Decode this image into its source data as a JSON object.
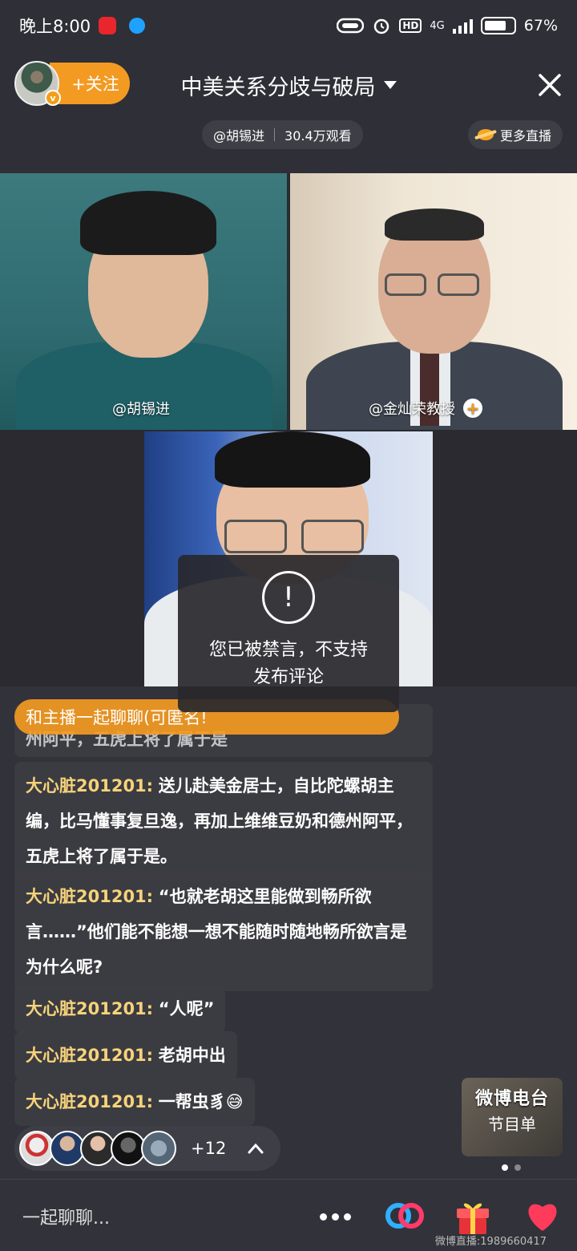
{
  "status_bar": {
    "time": "晚上8:00",
    "network": "4G",
    "hd": "HD",
    "battery": "67%"
  },
  "header": {
    "follow_label": "+关注",
    "title": "中美关系分歧与破局",
    "host": "@胡锡进",
    "views": "30.4万观看",
    "more_live": "更多直播"
  },
  "video": {
    "tile1_label": "@胡锡进",
    "tile2_label": "@金灿荣教授"
  },
  "toast": {
    "icon": "!",
    "message": "您已被禁言，不支持发布评论"
  },
  "chat": {
    "prompt_banner": "和主播一起聊聊(可匿名!",
    "partial_line": "州阿平，五虎上将了属于是",
    "messages": [
      {
        "user": "大心脏201201:",
        "text": "送儿赴美金居士，自比陀螺胡主编，比马懂事复旦逸，再加上维维豆奶和德州阿平，五虎上将了属于是。"
      },
      {
        "user": "大心脏201201:",
        "text": "“也就老胡这里能做到畅所欲言……”他们能不能想一想不能随时随地畅所欲言是为什么呢?"
      },
      {
        "user": "大心脏201201:",
        "text": "“人呢”"
      },
      {
        "user": "大心脏201201:",
        "text": "老胡中出"
      },
      {
        "user": "大心脏201201:",
        "text": "一帮虫豸😅"
      }
    ]
  },
  "viewers": {
    "count": "+12"
  },
  "radio_card": {
    "title": "微博电台",
    "subtitle": "节目单"
  },
  "bottom_bar": {
    "input_placeholder": "一起聊聊...",
    "watermark": "微博直播:1989660417"
  },
  "colors": {
    "accent": "#f39a22",
    "username": "#f6d37a",
    "background": "#32323a"
  }
}
